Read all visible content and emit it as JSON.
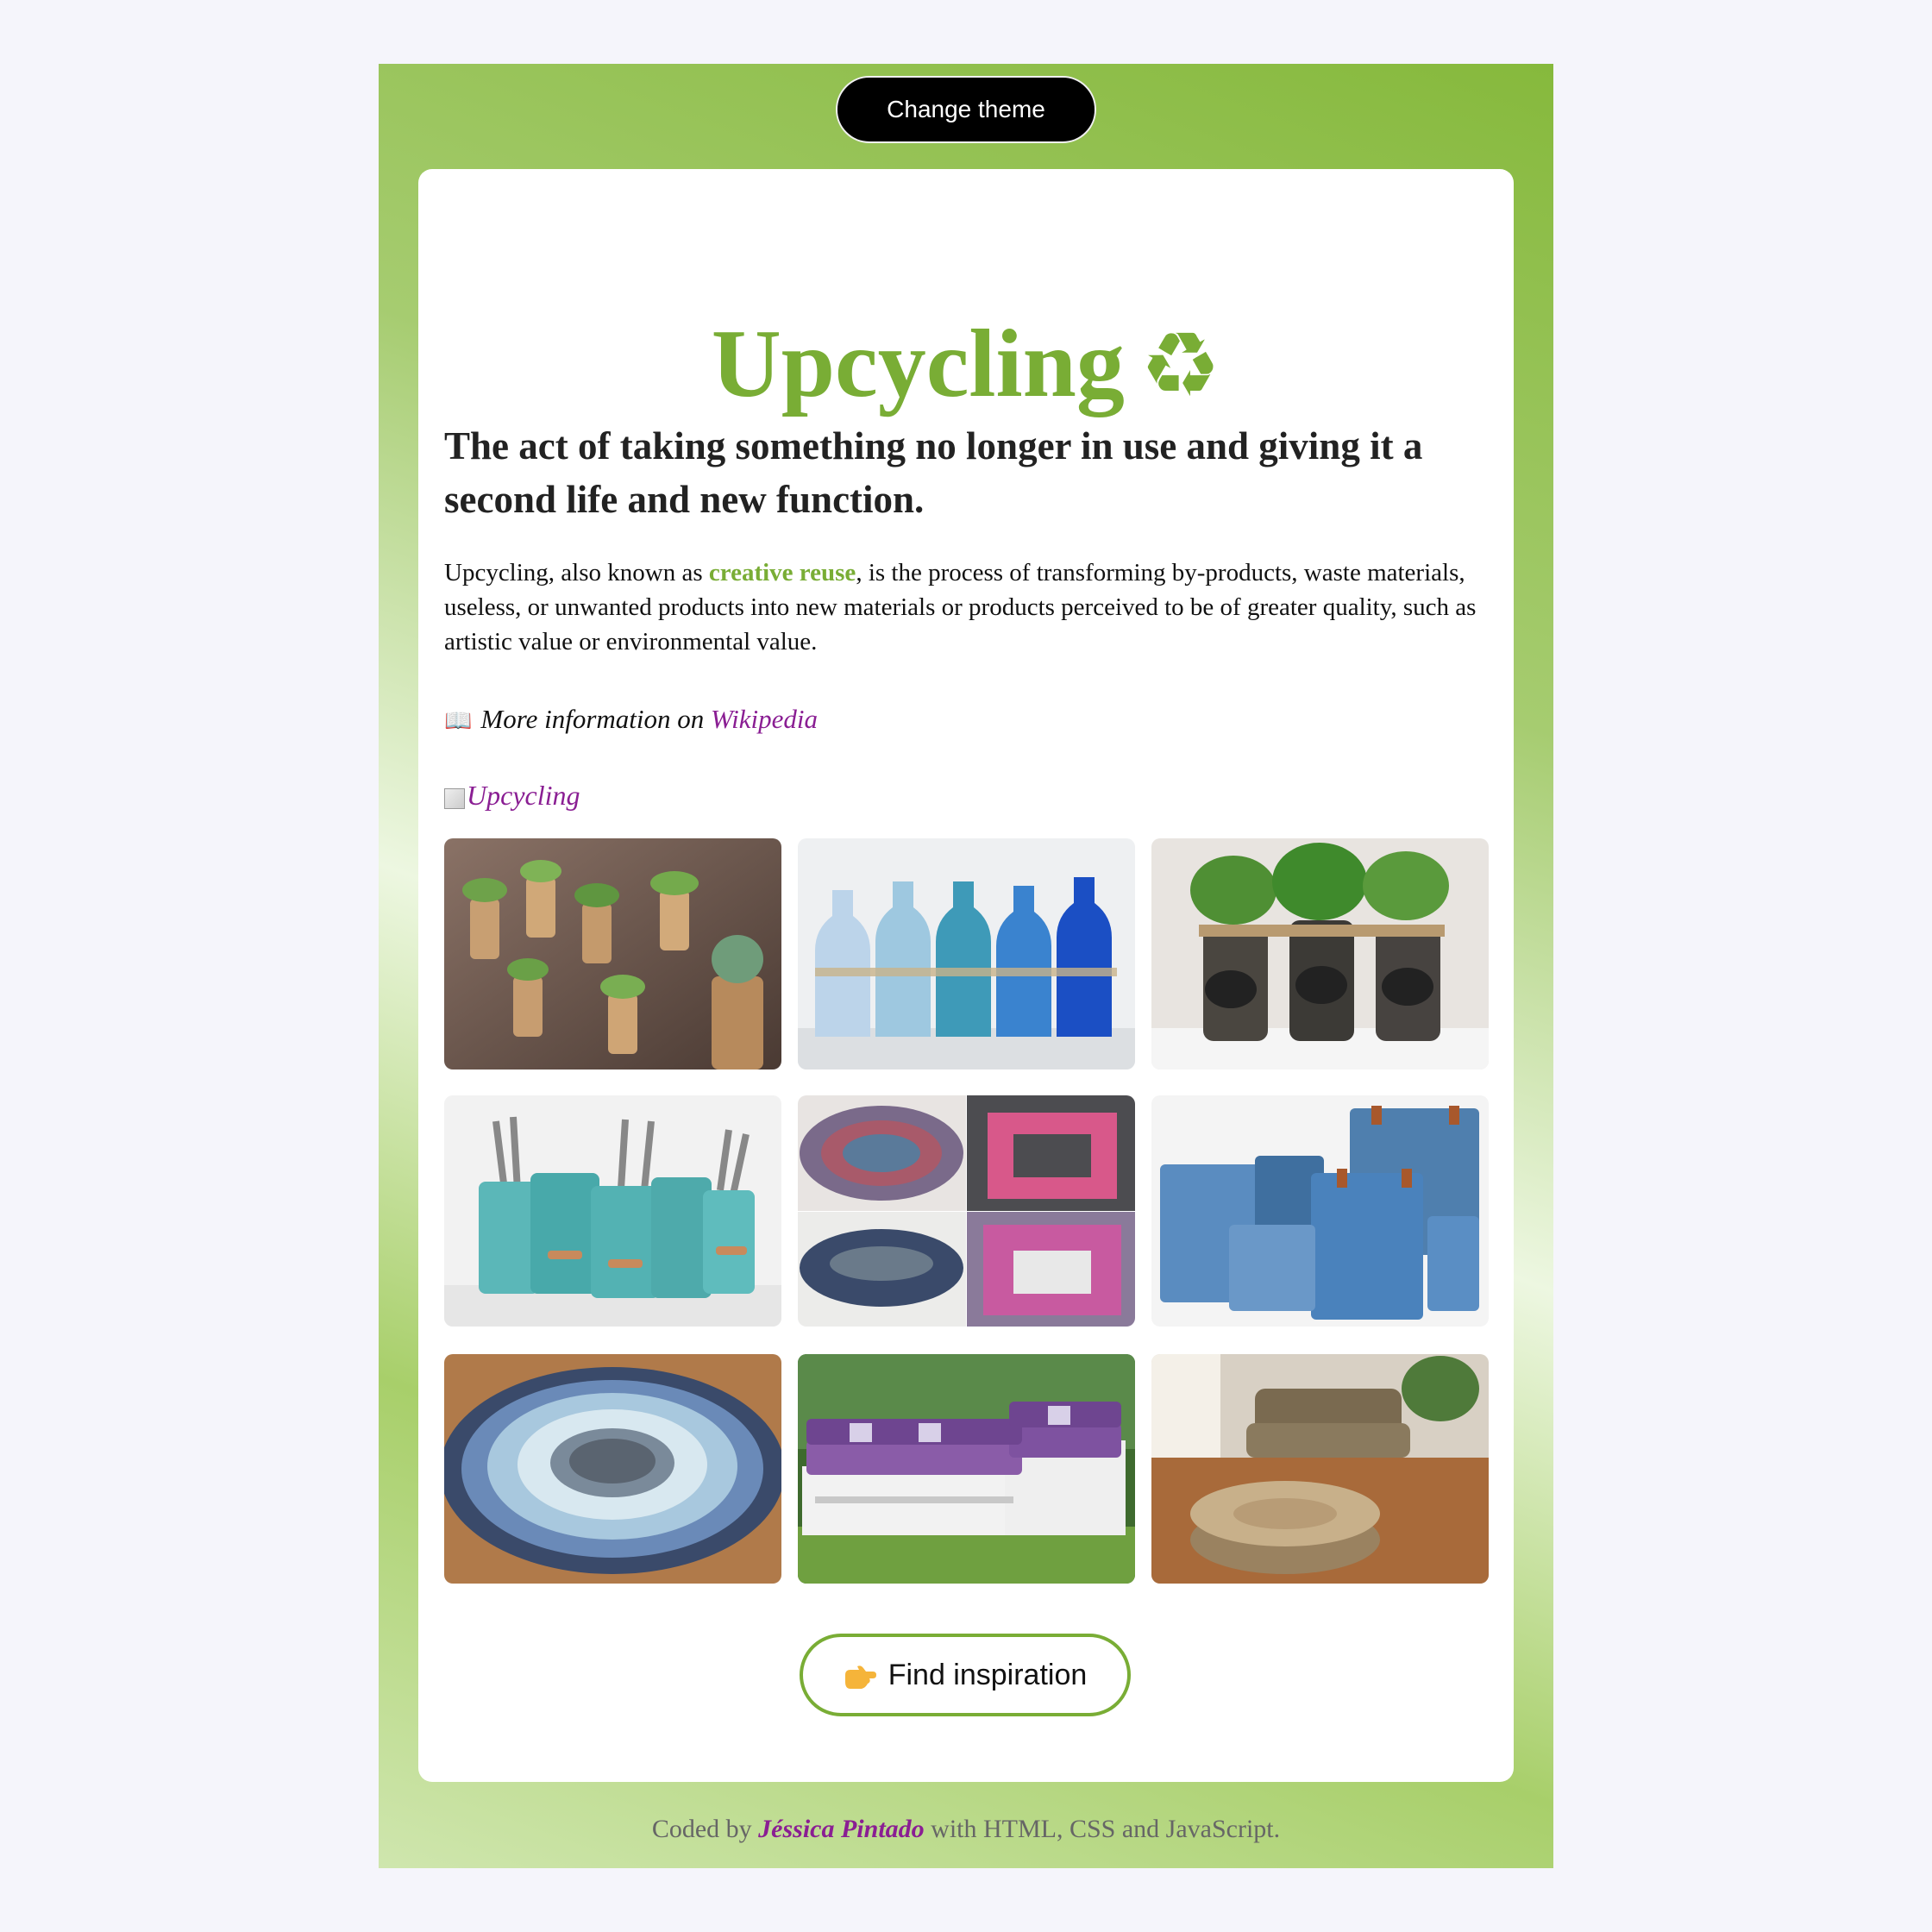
{
  "header": {
    "theme_button": "Change theme"
  },
  "card": {
    "title": "Upcycling",
    "title_icon": "♻",
    "subtitle": "The act of taking something no longer in use and giving it a second life and new function.",
    "description_before": "Upcycling, also known as ",
    "description_highlight": "creative reuse",
    "description_after": ", is the process of transforming by-products, waste materials, useless, or unwanted products into new materials or products perceived to be of greater quality, such as artistic value or environmental value.",
    "more_info_icon": "📖",
    "more_info_text": "More information on ",
    "more_info_link": "Wikipedia",
    "broken_image_alt": "Upcycling",
    "gallery": [
      {
        "name": "cork-planters",
        "icon": "cork-succulent-magnets"
      },
      {
        "name": "beach-bottles",
        "icon": "painted-bottles"
      },
      {
        "name": "jar-herbs",
        "icon": "mason-jar-herbs"
      },
      {
        "name": "tin-can-caddy",
        "icon": "tin-can-cutlery-holder"
      },
      {
        "name": "paper-bowls-frames",
        "icon": "rolled-paper-crafts"
      },
      {
        "name": "denim-baskets",
        "icon": "denim-storage-bins"
      },
      {
        "name": "rag-rug",
        "icon": "round-rag-rug"
      },
      {
        "name": "pallet-sofa",
        "icon": "pallet-outdoor-sofa"
      },
      {
        "name": "rope-ottoman",
        "icon": "tire-rope-ottoman"
      }
    ],
    "find_button_icon": "👉",
    "find_button": "Find inspiration"
  },
  "footer": {
    "before": "Coded by ",
    "author": "Jéssica Pintado",
    "after": " with HTML, CSS and JavaScript."
  },
  "colors": {
    "accent": "#79ad35",
    "link": "#8a1e93",
    "button_dark": "#000000"
  }
}
